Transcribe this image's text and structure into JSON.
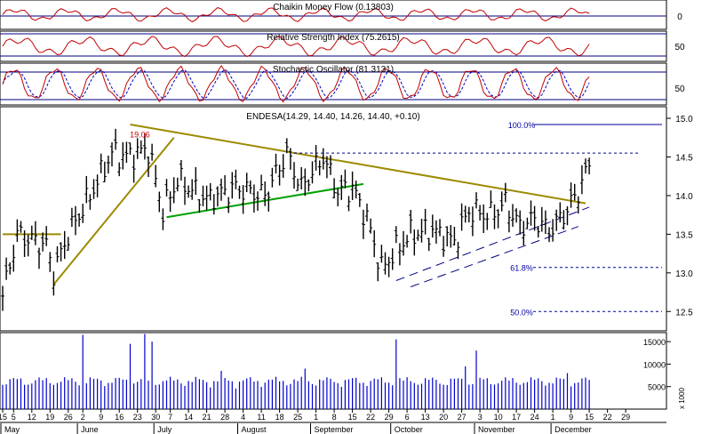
{
  "colors": {
    "background": "#ffffff",
    "frame": "#000000",
    "price_bars": "#000000",
    "panel_line": "#000080",
    "cmf_line": "#c00000",
    "rsi_line": "#c00000",
    "stoch_k": "#c00000",
    "stoch_d": "#0000c0",
    "volume_bars": "#0000cc",
    "olive_trend": "#9c8a00",
    "green_trend": "#00a000",
    "fib_line": "#0000a0",
    "channel": "#000080"
  },
  "chart_data": {
    "type": "bar",
    "panels": [
      {
        "id": "cmf",
        "title": "Chaikin Money Flow (0.13803)",
        "ticks": [
          "0"
        ],
        "reference": 0
      },
      {
        "id": "rsi",
        "title": "Relative Strength Index (75.2615)",
        "ticks": [
          "50"
        ],
        "reference": 50
      },
      {
        "id": "stoch",
        "title": "Stochastic Oscillator (81.3131)",
        "ticks": [
          "50"
        ],
        "reference": 50
      }
    ],
    "price": {
      "title": "ENDESA(14.29, 14.40, 14.26, 14.40, +0.10)",
      "ylim": [
        12.25,
        15.15
      ],
      "yticks": [
        "15.0",
        "14.5",
        "14.0",
        "13.5",
        "13.0",
        "12.5"
      ],
      "high_annotation": "19.06",
      "x_domain": [
        0,
        170
      ],
      "anchors": [
        {
          "x": 0,
          "close": 12.7
        },
        {
          "x": 4,
          "close": 13.5
        },
        {
          "x": 12,
          "close": 13.35
        },
        {
          "x": 14,
          "close": 13.0
        },
        {
          "x": 18,
          "close": 13.5
        },
        {
          "x": 24,
          "close": 14.0
        },
        {
          "x": 30,
          "close": 14.55
        },
        {
          "x": 34,
          "close": 14.5
        },
        {
          "x": 40,
          "close": 14.6
        },
        {
          "x": 44,
          "close": 13.8
        },
        {
          "x": 48,
          "close": 14.2
        },
        {
          "x": 56,
          "close": 13.95
        },
        {
          "x": 64,
          "close": 14.1
        },
        {
          "x": 72,
          "close": 14.0
        },
        {
          "x": 78,
          "close": 14.55
        },
        {
          "x": 82,
          "close": 14.1
        },
        {
          "x": 88,
          "close": 14.5
        },
        {
          "x": 92,
          "close": 14.05
        },
        {
          "x": 96,
          "close": 14.1
        },
        {
          "x": 100,
          "close": 13.7
        },
        {
          "x": 104,
          "close": 13.05
        },
        {
          "x": 108,
          "close": 13.3
        },
        {
          "x": 112,
          "close": 13.5
        },
        {
          "x": 118,
          "close": 13.55
        },
        {
          "x": 124,
          "close": 13.4
        },
        {
          "x": 128,
          "close": 13.8
        },
        {
          "x": 134,
          "close": 13.75
        },
        {
          "x": 138,
          "close": 13.9
        },
        {
          "x": 142,
          "close": 13.6
        },
        {
          "x": 146,
          "close": 13.7
        },
        {
          "x": 150,
          "close": 13.55
        },
        {
          "x": 154,
          "close": 13.75
        },
        {
          "x": 158,
          "close": 14.05
        },
        {
          "x": 161,
          "close": 14.4
        }
      ],
      "bar_range": 0.24
    },
    "fibonacci": [
      {
        "label": "100.0%",
        "value": 14.92
      },
      {
        "label": "61.8%",
        "value": 13.07
      },
      {
        "label": "50.0%",
        "value": 12.5
      }
    ],
    "trendlines": [
      {
        "kind": "olive",
        "points": [
          [
            0,
            13.5
          ],
          [
            16,
            13.5
          ]
        ]
      },
      {
        "kind": "olive",
        "points": [
          [
            14,
            12.85
          ],
          [
            47,
            14.75
          ]
        ]
      },
      {
        "kind": "olive",
        "points": [
          [
            35,
            14.92
          ],
          [
            160,
            13.9
          ]
        ]
      },
      {
        "kind": "green",
        "points": [
          [
            45,
            13.72
          ],
          [
            99,
            14.15
          ]
        ]
      },
      {
        "kind": "dash",
        "points": [
          [
            108,
            12.9
          ],
          [
            161,
            13.85
          ]
        ]
      },
      {
        "kind": "dash",
        "points": [
          [
            112,
            12.82
          ],
          [
            158,
            13.6
          ]
        ]
      },
      {
        "kind": "dotted",
        "points": [
          [
            80,
            14.55
          ],
          [
            175,
            14.55
          ]
        ]
      }
    ],
    "volume": {
      "yticks": [
        "15000",
        "10000",
        "5000"
      ],
      "ylim": [
        0,
        17000
      ],
      "unit_label": "x 1000",
      "base": 4500,
      "spikes": [
        {
          "x": 22,
          "value": 16500
        },
        {
          "x": 35,
          "value": 14500
        },
        {
          "x": 39,
          "value": 16700
        },
        {
          "x": 41,
          "value": 15000
        },
        {
          "x": 60,
          "value": 8500
        },
        {
          "x": 83,
          "value": 9000
        },
        {
          "x": 108,
          "value": 15500
        },
        {
          "x": 127,
          "value": 9500
        },
        {
          "x": 130,
          "value": 13000
        },
        {
          "x": 155,
          "value": 8000
        }
      ]
    },
    "x_axis": {
      "day_ticks": [
        {
          "x": 0,
          "label": "15"
        },
        {
          "x": 3,
          "label": "5"
        },
        {
          "x": 8,
          "label": "12"
        },
        {
          "x": 13,
          "label": "19"
        },
        {
          "x": 18,
          "label": "26"
        },
        {
          "x": 22,
          "label": "2"
        },
        {
          "x": 27,
          "label": "9"
        },
        {
          "x": 32,
          "label": "16"
        },
        {
          "x": 37,
          "label": "23"
        },
        {
          "x": 42,
          "label": "30"
        },
        {
          "x": 46,
          "label": "7"
        },
        {
          "x": 51,
          "label": "14"
        },
        {
          "x": 56,
          "label": "21"
        },
        {
          "x": 61,
          "label": "28"
        },
        {
          "x": 66,
          "label": "4"
        },
        {
          "x": 71,
          "label": "11"
        },
        {
          "x": 76,
          "label": "18"
        },
        {
          "x": 81,
          "label": "25"
        },
        {
          "x": 86,
          "label": "1"
        },
        {
          "x": 91,
          "label": "8"
        },
        {
          "x": 96,
          "label": "15"
        },
        {
          "x": 101,
          "label": "22"
        },
        {
          "x": 106,
          "label": "29"
        },
        {
          "x": 111,
          "label": "6"
        },
        {
          "x": 116,
          "label": "13"
        },
        {
          "x": 121,
          "label": "20"
        },
        {
          "x": 126,
          "label": "27"
        },
        {
          "x": 131,
          "label": "3"
        },
        {
          "x": 136,
          "label": "10"
        },
        {
          "x": 141,
          "label": "17"
        },
        {
          "x": 146,
          "label": "24"
        },
        {
          "x": 151,
          "label": "1"
        },
        {
          "x": 156,
          "label": "9"
        },
        {
          "x": 161,
          "label": "15"
        },
        {
          "x": 166,
          "label": "22"
        },
        {
          "x": 171,
          "label": "29"
        }
      ],
      "months": [
        {
          "x": 0,
          "label": "May"
        },
        {
          "x": 21,
          "label": "June"
        },
        {
          "x": 42,
          "label": "July"
        },
        {
          "x": 65,
          "label": "August"
        },
        {
          "x": 85,
          "label": "September"
        },
        {
          "x": 107,
          "label": "October"
        },
        {
          "x": 130,
          "label": "November"
        },
        {
          "x": 151,
          "label": "December"
        }
      ]
    }
  }
}
